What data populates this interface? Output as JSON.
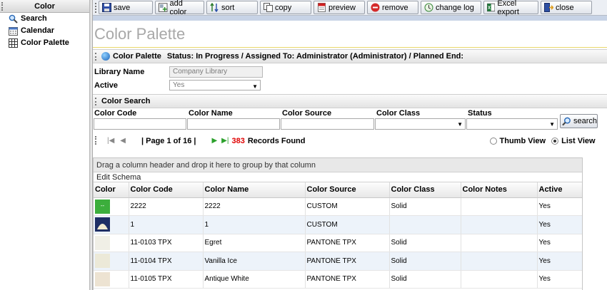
{
  "nav": {
    "title": "Color",
    "items": [
      {
        "label": "Search",
        "icon": "search-icon"
      },
      {
        "label": "Calendar",
        "icon": "calendar-icon"
      },
      {
        "label": "Color Palette",
        "icon": "grid-icon"
      }
    ]
  },
  "toolbar": {
    "buttons": [
      {
        "label": "save",
        "icon": "save-icon"
      },
      {
        "label": "add color",
        "icon": "add-icon"
      },
      {
        "label": "sort",
        "icon": "sort-icon"
      },
      {
        "label": "copy",
        "icon": "copy-icon"
      },
      {
        "label": "preview",
        "icon": "pdf-icon"
      },
      {
        "label": "remove",
        "icon": "remove-icon"
      },
      {
        "label": "change log",
        "icon": "changelog-icon"
      },
      {
        "label": "Excel export",
        "icon": "excel-icon"
      },
      {
        "label": "close",
        "icon": "close-icon"
      }
    ]
  },
  "page_title": "Color Palette",
  "header_section": {
    "title": "Color Palette",
    "status": "Status: In Progress / Assigned To: Administrator (Administrator) / Planned End:"
  },
  "form": {
    "library_label": "Library Name",
    "library_value": "Company Library",
    "active_label": "Active",
    "active_value": "Yes"
  },
  "color_search": {
    "title": "Color Search",
    "fields": [
      "Color Code",
      "Color Name",
      "Color Source",
      "Color Class",
      "Status"
    ],
    "search_label": "search"
  },
  "pager": {
    "page_text": "| Page 1 of 16 |",
    "record_count": "383",
    "records_label": "Records Found",
    "thumb_view": "Thumb View",
    "list_view": "List View"
  },
  "grid": {
    "group_hint": "Drag a column header and drop it here to group by that column",
    "edit_schema": "Edit Schema",
    "columns": [
      "Color",
      "Color Code",
      "Color Name",
      "Color Source",
      "Color Class",
      "Color Notes",
      "Active"
    ],
    "rows": [
      {
        "code": "2222",
        "name": "2222",
        "source": "CUSTOM",
        "class": "Solid",
        "notes": "",
        "active": "Yes",
        "swatch": "#3cae3c",
        "swatch_mark": "--"
      },
      {
        "code": "1",
        "name": "1",
        "source": "CUSTOM",
        "class": "",
        "notes": "",
        "active": "Yes",
        "swatch": "#1e2e64",
        "swatch_mark": ""
      },
      {
        "code": "11-0103 TPX",
        "name": "Egret",
        "source": "PANTONE TPX",
        "class": "Solid",
        "notes": "",
        "active": "Yes",
        "swatch": "#f0efe6",
        "swatch_mark": ""
      },
      {
        "code": "11-0104 TPX",
        "name": "Vanilla Ice",
        "source": "PANTONE TPX",
        "class": "Solid",
        "notes": "",
        "active": "Yes",
        "swatch": "#ece9d8",
        "swatch_mark": ""
      },
      {
        "code": "11-0105 TPX",
        "name": "Antique White",
        "source": "PANTONE TPX",
        "class": "Solid",
        "notes": "",
        "active": "Yes",
        "swatch": "#ede3d2",
        "swatch_mark": ""
      }
    ]
  }
}
